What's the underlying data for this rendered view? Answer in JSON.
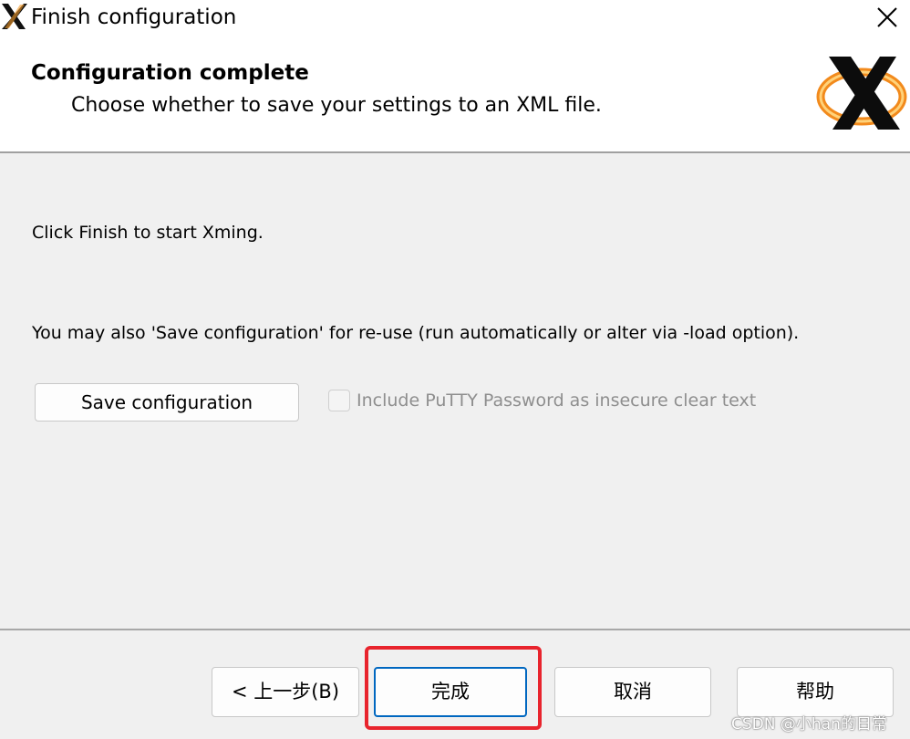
{
  "window": {
    "title": "Finish configuration",
    "app_icon": "xming-x-icon",
    "close_icon": "close-icon"
  },
  "header": {
    "title": "Configuration complete",
    "subtitle": "Choose whether to save your settings to an XML file.",
    "logo": "xming-logo"
  },
  "content": {
    "instruction": "Click Finish to start Xming.",
    "save_hint": "You may also 'Save configuration' for re-use (run automatically or alter via -load option).",
    "save_button": "Save configuration",
    "checkbox_label": "Include PuTTY Password as insecure clear text",
    "checkbox_checked": false
  },
  "footer": {
    "back_button": "< 上一步(B)",
    "finish_button": "完成",
    "cancel_button": "取消",
    "help_button": "帮助"
  },
  "annotation": {
    "highlight_color": "#e8242d"
  },
  "watermark": "CSDN @小han的日常"
}
